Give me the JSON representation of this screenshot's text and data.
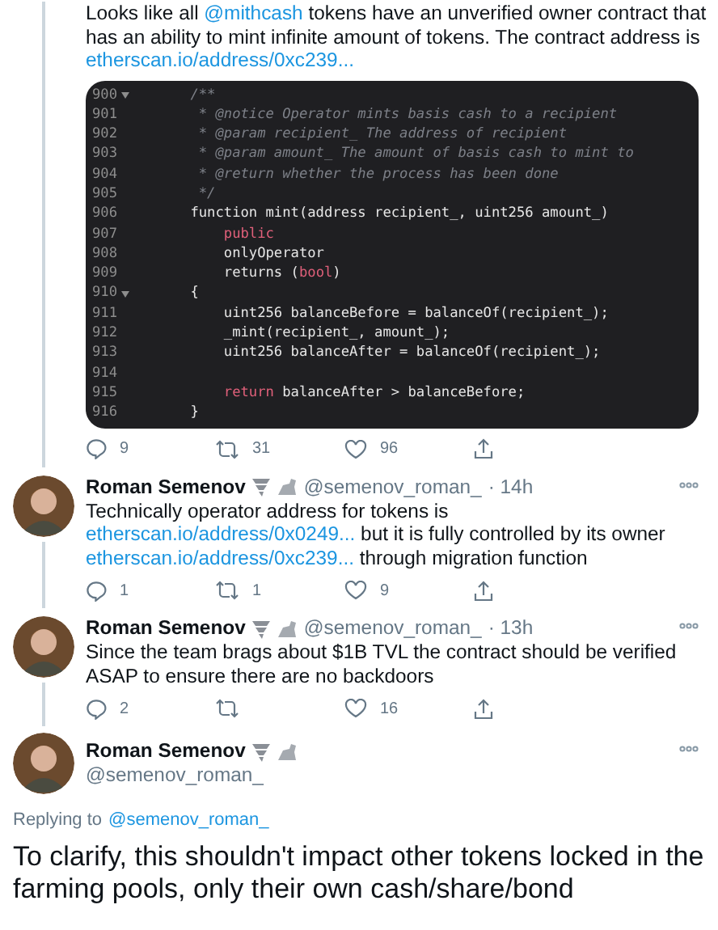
{
  "thread": [
    {
      "lines": [
        [
          {
            "text": "Looks like all ",
            "link": false
          },
          {
            "text": "@mithcash",
            "link": true
          },
          {
            "text": " tokens have an unverified owner contract that",
            "link": false
          }
        ],
        [
          {
            "text": "has an ability to mint infinite amount of tokens. The contract address is",
            "link": false
          }
        ],
        [
          {
            "text": "etherscan.io/address/0xc239...",
            "link": true
          }
        ]
      ],
      "code": [
        {
          "number": "900",
          "fold": true,
          "segments": [
            {
              "text": "    /**",
              "kind": "comment"
            }
          ]
        },
        {
          "number": "901",
          "fold": false,
          "segments": [
            {
              "text": "     * @notice Operator mints basis cash to a recipient",
              "kind": "comment"
            }
          ]
        },
        {
          "number": "902",
          "fold": false,
          "segments": [
            {
              "text": "     * @param recipient_ The address of recipient",
              "kind": "comment"
            }
          ]
        },
        {
          "number": "903",
          "fold": false,
          "segments": [
            {
              "text": "     * @param amount_ The amount of basis cash to mint to",
              "kind": "comment"
            }
          ]
        },
        {
          "number": "904",
          "fold": false,
          "segments": [
            {
              "text": "     * @return whether the process has been done",
              "kind": "comment"
            }
          ]
        },
        {
          "number": "905",
          "fold": false,
          "segments": [
            {
              "text": "     */",
              "kind": "comment"
            }
          ]
        },
        {
          "number": "906",
          "fold": false,
          "segments": [
            {
              "text": "    function mint(address recipient_, uint256 amount_)",
              "kind": "plain"
            }
          ]
        },
        {
          "number": "907",
          "fold": false,
          "segments": [
            {
              "text": "        public",
              "kind": "keyword"
            }
          ]
        },
        {
          "number": "908",
          "fold": false,
          "segments": [
            {
              "text": "        onlyOperator",
              "kind": "plain"
            }
          ]
        },
        {
          "number": "909",
          "fold": false,
          "segments": [
            {
              "text": "        returns (",
              "kind": "plain"
            },
            {
              "text": "bool",
              "kind": "keyword"
            },
            {
              "text": ")",
              "kind": "plain"
            }
          ]
        },
        {
          "number": "910",
          "fold": true,
          "segments": [
            {
              "text": "    {",
              "kind": "plain"
            }
          ]
        },
        {
          "number": "911",
          "fold": false,
          "segments": [
            {
              "text": "        uint256 balanceBefore = balanceOf(recipient_);",
              "kind": "plain"
            }
          ]
        },
        {
          "number": "912",
          "fold": false,
          "segments": [
            {
              "text": "        _mint(recipient_, amount_);",
              "kind": "plain"
            }
          ]
        },
        {
          "number": "913",
          "fold": false,
          "segments": [
            {
              "text": "        uint256 balanceAfter = balanceOf(recipient_);",
              "kind": "plain"
            }
          ]
        },
        {
          "number": "914",
          "fold": false
        },
        {
          "number": "915",
          "fold": false,
          "segments": [
            {
              "text": "        return",
              "kind": "keyword"
            },
            {
              "text": " balanceAfter > balanceBefore;",
              "kind": "plain"
            }
          ]
        },
        {
          "number": "916",
          "fold": false,
          "segments": [
            {
              "text": "    }",
              "kind": "plain"
            }
          ]
        }
      ],
      "actions": [
        {
          "kind": "reply",
          "count": "9"
        },
        {
          "kind": "retweet",
          "count": "31"
        },
        {
          "kind": "like",
          "count": "96"
        },
        {
          "kind": "share"
        }
      ]
    },
    {
      "author": {
        "name": "Roman Semenov",
        "handle": "@semenov_roman_",
        "time": "· 14h"
      },
      "lines": [
        [
          {
            "text": "Technically operator address for tokens is",
            "link": false
          }
        ],
        [
          {
            "text": "etherscan.io/address/0x0249...",
            "link": true
          },
          {
            "text": " but it is fully controlled by its owner",
            "link": false
          }
        ],
        [
          {
            "text": "etherscan.io/address/0xc239...",
            "link": true
          },
          {
            "text": " through migration function",
            "link": false
          }
        ]
      ],
      "actions": [
        {
          "kind": "reply",
          "count": "1"
        },
        {
          "kind": "retweet",
          "count": "1"
        },
        {
          "kind": "like",
          "count": "9"
        },
        {
          "kind": "share"
        }
      ]
    },
    {
      "author": {
        "name": "Roman Semenov",
        "handle": "@semenov_roman_",
        "time": "· 13h"
      },
      "lines": [
        [
          {
            "text": "Since the team brags about $1B TVL the contract should be verified",
            "link": false
          }
        ],
        [
          {
            "text": "ASAP to ensure there are no backdoors",
            "link": false
          }
        ]
      ],
      "actions": [
        {
          "kind": "reply",
          "count": "2"
        },
        {
          "kind": "retweet"
        },
        {
          "kind": "like",
          "count": "16"
        },
        {
          "kind": "share"
        }
      ]
    }
  ],
  "main_tweet": {
    "name": "Roman Semenov",
    "handle": "@semenov_roman_",
    "replying_label": "Replying to",
    "replying_handle": "@semenov_roman_",
    "text": "To clarify, this shouldn't impact other tokens locked in the farming pools, only their own cash/share/bond"
  }
}
